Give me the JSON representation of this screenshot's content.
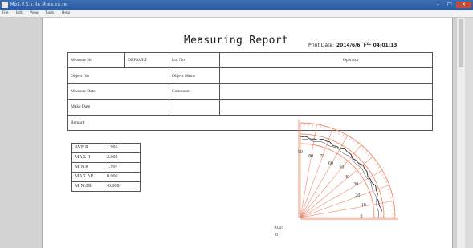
{
  "window": {
    "title": "MoS.P.S.s.Re.M.ea.su.re.",
    "minimize": "–",
    "maximize": "□",
    "close": "✕"
  },
  "menu": [
    "File",
    "Edit",
    "View",
    "Tools",
    "Help"
  ],
  "report": {
    "title": "Measuring Report",
    "print_date_label": "Print Date:",
    "print_date_value": "2014/6/6 下午 04:01:13"
  },
  "header_table": [
    [
      "Measure No",
      "DEFAULT",
      "Lot No",
      "",
      "Operator"
    ],
    [
      "Object No",
      "",
      "Object Name",
      "",
      ""
    ],
    [
      "Measure Date",
      "",
      "Comment",
      "",
      ""
    ],
    [
      "Make Date",
      "",
      "",
      "",
      ""
    ],
    [
      "Remark",
      "",
      "",
      "",
      ""
    ]
  ],
  "stats": [
    {
      "label": "AVE R",
      "value": "1.995"
    },
    {
      "label": "MAX R",
      "value": "2.003"
    },
    {
      "label": "MIN R",
      "value": "1.997"
    },
    {
      "label": "MAX ΔR",
      "value": "0.006"
    },
    {
      "label": "MIN ΔR",
      "value": "-0.008"
    }
  ],
  "polar_plot": {
    "angle_labels": [
      "90",
      "80",
      "70",
      "60",
      "50",
      "40",
      "30",
      "20",
      "10",
      "0"
    ],
    "scale_value": "-0.01",
    "origin_label": "0",
    "grid_color": "#f08a6a",
    "profile_color": "#2a2a2a"
  }
}
